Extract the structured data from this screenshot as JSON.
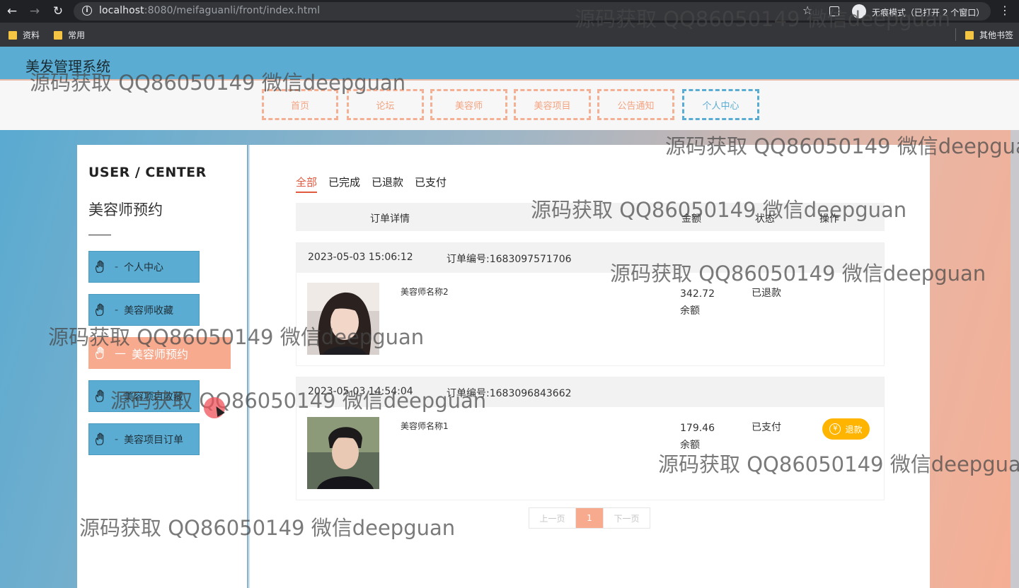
{
  "browser": {
    "url_host": "localhost",
    "url_rest": ":8080/meifaguanli/front/index.html",
    "incognito_label": "无痕模式（已打开 2 个窗口）",
    "bookmarks": [
      "资料",
      "常用"
    ],
    "other_bookmarks": "其他书签"
  },
  "site": {
    "title": "美发管理系统",
    "nav": [
      "首页",
      "论坛",
      "美容师",
      "美容项目",
      "公告通知",
      "个人中心"
    ],
    "nav_active_index": 5
  },
  "sidebar": {
    "title": "USER / CENTER",
    "subtitle": "美容师预约",
    "items": [
      {
        "dash": "-",
        "label": "个人中心"
      },
      {
        "dash": "-",
        "label": "美容师收藏"
      },
      {
        "dash": "—",
        "label": "美容师预约"
      },
      {
        "dash": "-",
        "label": "美容项目收藏"
      },
      {
        "dash": "-",
        "label": "美容项目订单"
      }
    ],
    "active_index": 2
  },
  "main": {
    "tabs": [
      "全部",
      "已完成",
      "已退款",
      "已支付"
    ],
    "active_tab": "全部",
    "table_headers": {
      "detail": "订单详情",
      "amount": "金额",
      "status": "状态",
      "action": "操作"
    },
    "orders": [
      {
        "time": "2023-05-03 15:06:12",
        "order_no": "订单编号:1683097571706",
        "name": "美容师名称2",
        "price": "342.72",
        "pay_method": "余额",
        "status": "已退款",
        "action": ""
      },
      {
        "time": "2023-05-03 14:54:04",
        "order_no": "订单编号:1683096843662",
        "name": "美容师名称1",
        "price": "179.46",
        "pay_method": "余额",
        "status": "已支付",
        "action": "退款"
      }
    ],
    "pager": {
      "prev": "上一页",
      "current": "1",
      "next": "下一页"
    }
  },
  "watermark": "源码获取 QQ86050149 微信deepguan"
}
